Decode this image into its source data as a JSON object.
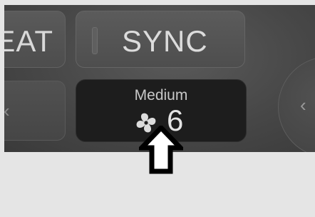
{
  "climate": {
    "heat_label": "EAT",
    "sync_label": "SYNC",
    "left_arrow": "‹",
    "right_arrow": "‹",
    "fan": {
      "mode": "Medium",
      "level": "6",
      "icon": "fan-icon"
    }
  },
  "pointer": {
    "icon": "up-arrow-icon"
  }
}
